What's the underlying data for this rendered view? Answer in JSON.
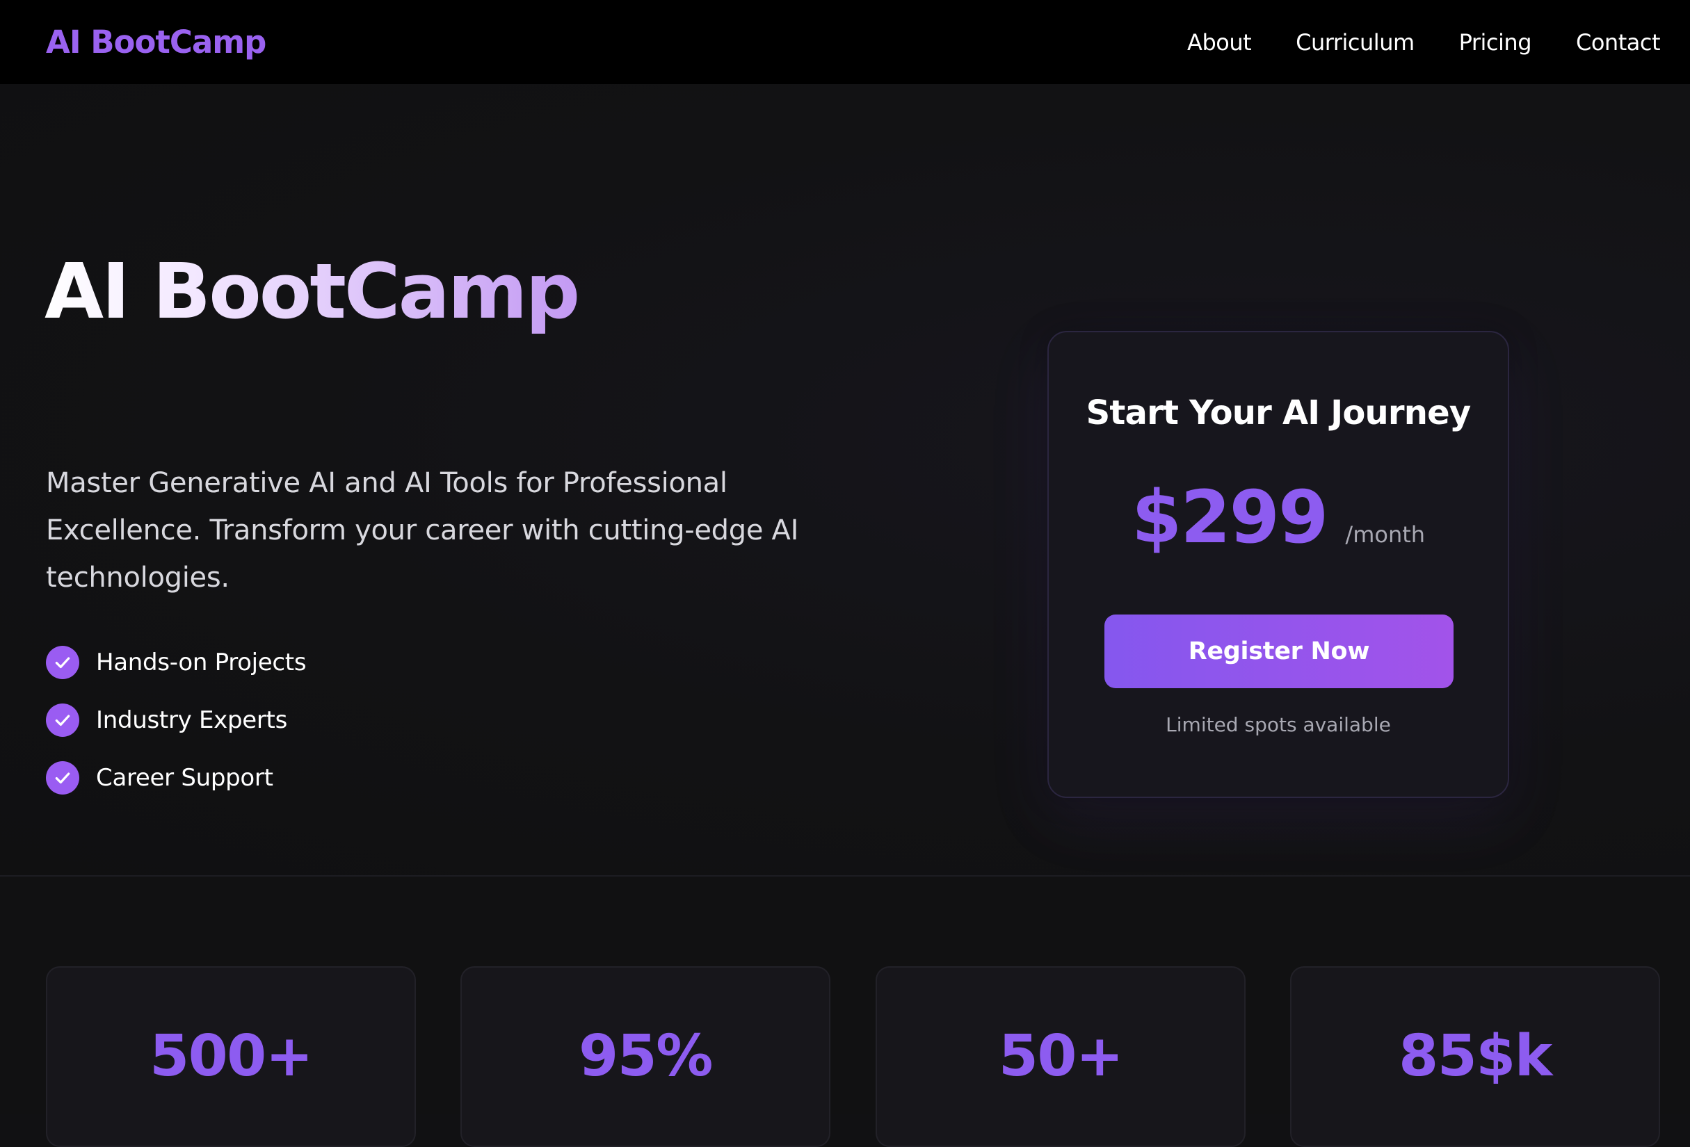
{
  "nav": {
    "brand": "AI BootCamp",
    "links": [
      {
        "label": "About"
      },
      {
        "label": "Curriculum"
      },
      {
        "label": "Pricing"
      },
      {
        "label": "Contact"
      }
    ]
  },
  "hero": {
    "title": "AI BootCamp",
    "description": "Master Generative AI and AI Tools for Professional Excellence. Transform your career with cutting-edge AI technologies.",
    "features": [
      {
        "label": "Hands-on Projects",
        "icon": "check-icon"
      },
      {
        "label": "Industry Experts",
        "icon": "check-icon"
      },
      {
        "label": "Career Support",
        "icon": "check-icon"
      }
    ]
  },
  "pricing_card": {
    "title": "Start Your AI Journey",
    "price": "$299",
    "period": "/month",
    "button_label": "Register Now",
    "note": "Limited spots available"
  },
  "stats": [
    {
      "value": "500+"
    },
    {
      "value": "95%"
    },
    {
      "value": "50+"
    },
    {
      "value": "85$k"
    }
  ],
  "colors": {
    "accent": "#8d5cf0",
    "brand": "#9a62f0",
    "background": "#111113",
    "navbar": "#000000"
  }
}
